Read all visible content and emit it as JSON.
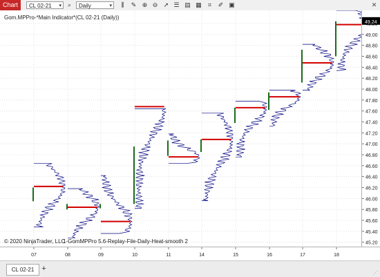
{
  "titlebar": {
    "chart_tab": "Chart",
    "instrument": "CL 02-21",
    "interval": "Daily",
    "close": "✕"
  },
  "icons": [
    "search-icon",
    "bars-icon",
    "pencil-icon",
    "zoom-in-icon",
    "zoom-out-icon",
    "pointer-icon",
    "properties-icon",
    "strategies-icon",
    "data-box-icon",
    "indicators-icon",
    "drawing-tools-icon",
    "templates-icon"
  ],
  "chart_data": {
    "type": "volume-profile",
    "indicator_label": "Gom.MPPro-*Main Indicator*(CL 02-21 (Daily))",
    "copyright": "© 2020 NinjaTrader, LLC",
    "footer_label": "1-GomMPPro 5.6-Replay-File-Daily-Heat-smooth 2",
    "x_ticks": [
      "07",
      "08",
      "09",
      "10",
      "11",
      "14",
      "15",
      "16",
      "17",
      "18"
    ],
    "y_ticks": [
      49.2,
      49.0,
      48.8,
      48.6,
      48.4,
      48.2,
      48.0,
      47.8,
      47.6,
      47.4,
      47.2,
      47.0,
      46.8,
      46.6,
      46.4,
      46.2,
      46.0,
      45.8,
      45.6,
      45.4,
      45.2
    ],
    "ylim": [
      45.12,
      49.44
    ],
    "last_price": 49.24,
    "sessions": [
      {
        "date": "07",
        "low": 45.48,
        "high": 46.64,
        "poc": 46.22,
        "open": 46.2,
        "close": 45.95
      },
      {
        "date": "08",
        "low": 45.28,
        "high": 46.18,
        "poc": 45.84,
        "open": 45.9,
        "close": 45.8
      },
      {
        "date": "09",
        "low": 45.36,
        "high": 46.42,
        "poc": 45.58,
        "open": 45.82,
        "close": 45.9
      },
      {
        "date": "10",
        "low": 45.82,
        "high": 47.64,
        "poc": 47.68,
        "open": 45.9,
        "close": 46.95
      },
      {
        "date": "11",
        "low": 46.64,
        "high": 47.18,
        "poc": 46.76,
        "open": 46.78,
        "close": 47.06
      },
      {
        "date": "14",
        "low": 45.96,
        "high": 47.56,
        "poc": 47.08,
        "open": 47.08,
        "close": 46.85
      },
      {
        "date": "15",
        "low": 46.76,
        "high": 47.78,
        "poc": 47.66,
        "open": 47.66,
        "close": 47.38
      },
      {
        "date": "16",
        "low": 47.32,
        "high": 47.98,
        "poc": 47.86,
        "open": 47.62,
        "close": 47.94
      },
      {
        "date": "17",
        "low": 47.98,
        "high": 48.82,
        "poc": 48.48,
        "open": 48.12,
        "close": 48.72
      },
      {
        "date": "18",
        "low": 48.34,
        "high": 49.44,
        "poc": 49.18,
        "open": 48.6,
        "close": 49.24
      }
    ],
    "grid": true
  },
  "bottom": {
    "tab_label": "CL 02-21",
    "add_tab": "+"
  },
  "colors": {
    "accent": "#c62828",
    "price_marker": "#000000",
    "poc": "#d40000",
    "outline": "#000080"
  }
}
